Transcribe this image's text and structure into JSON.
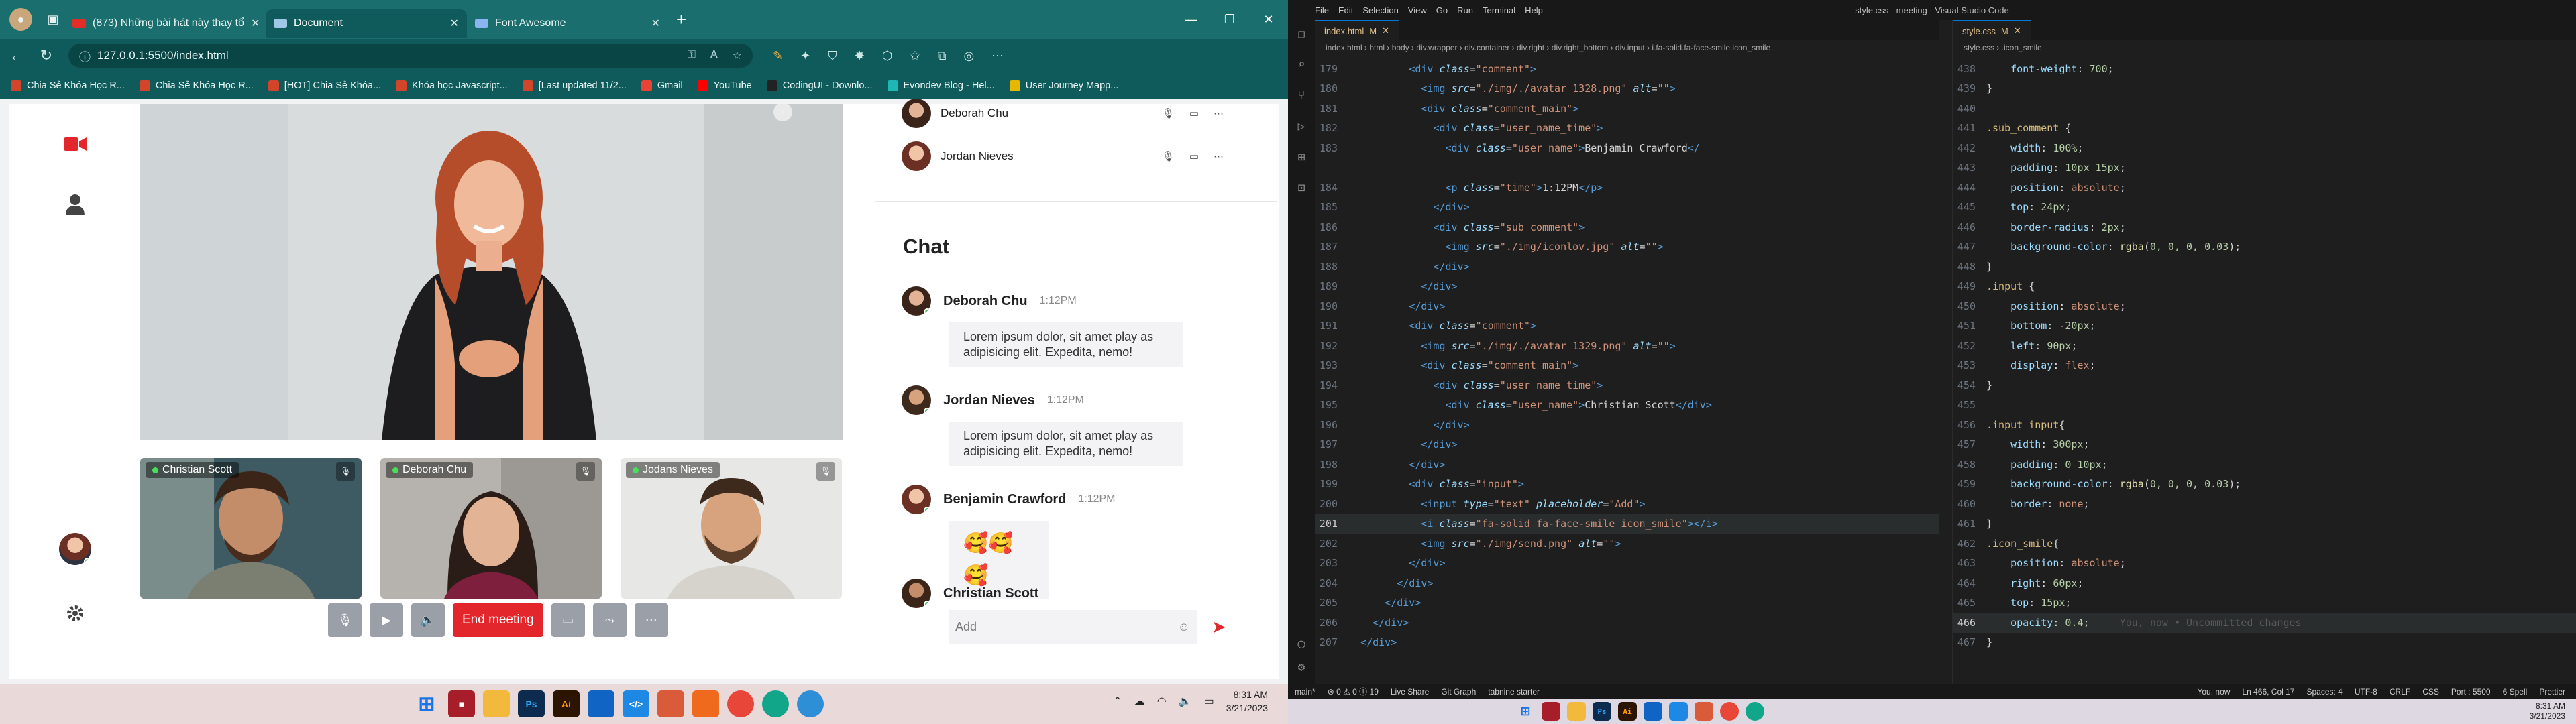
{
  "browser": {
    "tabs": [
      {
        "label": "(873) Những bài hát này thay tổ",
        "active": false
      },
      {
        "label": "Document",
        "active": true
      },
      {
        "label": "Font Awesome",
        "active": false
      }
    ],
    "url": "127.0.0.1:5500/index.html",
    "bookmarks": [
      "Chia Sẻ Khóa Học R...",
      "Chia Sẻ Khóa Học R...",
      "[HOT] Chia Sẻ Khóa...",
      "Khóa học Javascript...",
      "[Last updated 11/2...",
      "Gmail",
      "YouTube",
      "CodingUI - Downlo...",
      "Evondev Blog - Hel...",
      "User Journey Mapp..."
    ]
  },
  "meeting": {
    "thumbnails": [
      {
        "name": "Christian Scott"
      },
      {
        "name": "Deborah Chu"
      },
      {
        "name": "Jodans Nieves"
      }
    ],
    "end_label": "End meeting",
    "participants": [
      {
        "name": "Deborah Chu"
      },
      {
        "name": "Jordan Nieves"
      }
    ],
    "chat_title": "Chat",
    "messages": [
      {
        "name": "Deborah Chu",
        "time": "1:12PM",
        "text": "Lorem ipsum dolor, sit amet play as adipisicing elit. Expedita, nemo!"
      },
      {
        "name": "Jordan Nieves",
        "time": "1:12PM",
        "text": "Lorem ipsum dolor, sit amet play as adipisicing elit. Expedita, nemo!"
      },
      {
        "name": "Benjamin Crawford",
        "time": "1:12PM",
        "text": "🥰🥰🥰"
      },
      {
        "name": "Christian Scott",
        "time": "",
        "text": ""
      }
    ],
    "input_placeholder": "Add"
  },
  "taskbar": {
    "time": "8:31 AM",
    "date": "3/21/2023"
  },
  "vscode": {
    "window_title": "style.css - meeting - Visual Studio Code",
    "menu": [
      "File",
      "Edit",
      "Selection",
      "View",
      "Go",
      "Run",
      "Terminal",
      "Help"
    ],
    "html_tab": "index.html",
    "css_tab": "style.css",
    "html_crumbs": "index.html › html › body › div.wrapper › div.container › div.right › div.right_bottom › div.input › i.fa-solid.fa-face-smile.icon_smile",
    "css_crumbs": "style.css › .icon_smile",
    "status": {
      "branch": "main*",
      "problems": "⊗ 0 ⚠ 0 ⓘ 19",
      "live": "Live Share",
      "git": "Git Graph",
      "tabnine": "tabnine starter",
      "pos": "Ln 466, Col 17",
      "spaces": "Spaces: 4",
      "enc": "UTF-8",
      "eol": "CRLF",
      "lang": "CSS",
      "port": "Port : 5500",
      "spell": "6 Spell",
      "prettier": "Prettier",
      "blame": "You, now"
    },
    "ghost": "You, now • Uncommitted changes"
  }
}
